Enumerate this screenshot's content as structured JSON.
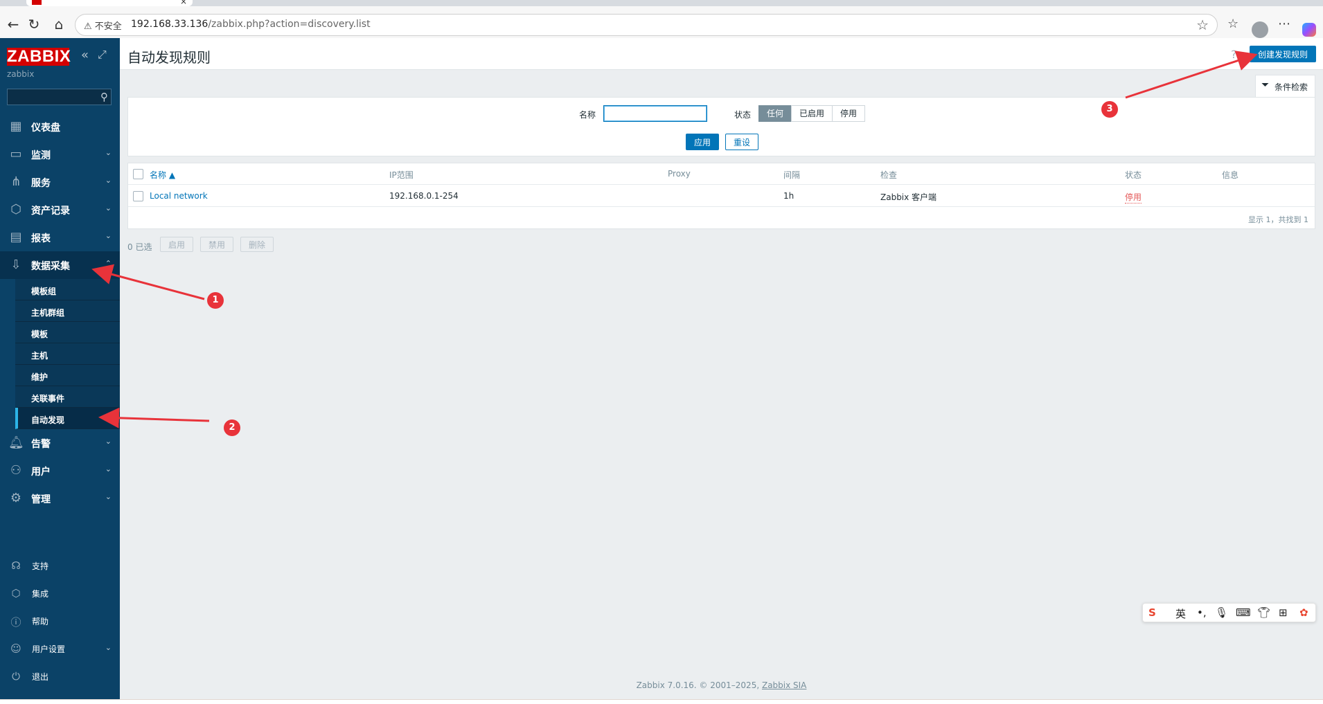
{
  "browser": {
    "insecure_label": "不安全",
    "url_host": "192.168.33.136",
    "url_path": "/zabbix.php?action=discovery.list"
  },
  "sidebar": {
    "logo": "ZABBIX",
    "server_name": "zabbix",
    "menu": [
      {
        "label": "仪表盘",
        "icon": "dashboard-icon"
      },
      {
        "label": "监测",
        "icon": "monitoring-icon"
      },
      {
        "label": "服务",
        "icon": "services-icon"
      },
      {
        "label": "资产记录",
        "icon": "inventory-icon"
      },
      {
        "label": "报表",
        "icon": "reports-icon"
      },
      {
        "label": "数据采集",
        "icon": "data-collection-icon"
      },
      {
        "label": "告警",
        "icon": "alerts-icon"
      },
      {
        "label": "用户",
        "icon": "users-icon"
      },
      {
        "label": "管理",
        "icon": "administration-icon"
      }
    ],
    "submenu": [
      "模板组",
      "主机群组",
      "模板",
      "主机",
      "维护",
      "关联事件",
      "自动发现"
    ],
    "bottom": [
      {
        "label": "支持",
        "icon": "support-icon"
      },
      {
        "label": "集成",
        "icon": "integrations-icon"
      },
      {
        "label": "帮助",
        "icon": "help-icon"
      },
      {
        "label": "用户设置",
        "icon": "user-settings-icon"
      },
      {
        "label": "退出",
        "icon": "signout-icon"
      }
    ]
  },
  "header": {
    "title": "自动发现规则",
    "create_label": "创建发现规则",
    "filter_tab_label": "条件检索"
  },
  "filter": {
    "name_label": "名称",
    "name_value": "",
    "status_label": "状态",
    "status_options": [
      "任何",
      "已启用",
      "停用"
    ],
    "status_selected": "任何",
    "apply_label": "应用",
    "reset_label": "重设"
  },
  "table": {
    "columns": [
      "名称 ▲",
      "IP范围",
      "Proxy",
      "间隔",
      "检查",
      "状态",
      "信息"
    ],
    "rows": [
      {
        "name": "Local network",
        "ip_range": "192.168.0.1-254",
        "proxy": "",
        "interval": "1h",
        "checks": "Zabbix 客户端",
        "status": "停用",
        "info": ""
      }
    ],
    "paging": "显示 1，共找到 1"
  },
  "mass_actions": {
    "selected_count": "0 已选",
    "enable_label": "启用",
    "disable_label": "禁用",
    "delete_label": "删除"
  },
  "footer": {
    "text": "Zabbix 7.0.16. © 2001–2025,",
    "company": "Zabbix SIA"
  },
  "ime": {
    "lang": "英"
  },
  "annotations": [
    "1",
    "2",
    "3"
  ],
  "colors": {
    "sidebar": "#0b4267",
    "primary": "#0275b8",
    "logo": "#d40000",
    "annotation": "#e8333a",
    "disabled_status": "#e45959"
  }
}
